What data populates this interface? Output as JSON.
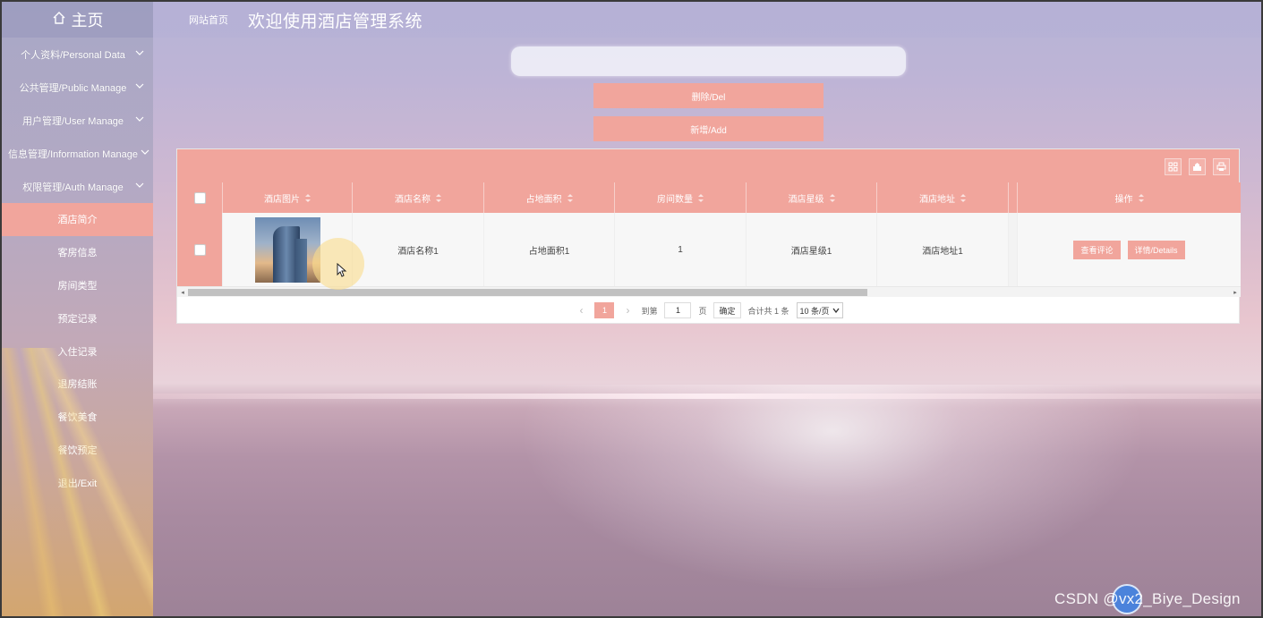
{
  "sidebar": {
    "home_label": "主页",
    "menus": [
      {
        "label": "个人资料/Personal Data"
      },
      {
        "label": "公共管理/Public Manage"
      },
      {
        "label": "用户管理/User Manage"
      },
      {
        "label": "信息管理/Information Manage"
      },
      {
        "label": "权限管理/Auth Manage"
      }
    ],
    "items": [
      {
        "label": "酒店简介",
        "active": true
      },
      {
        "label": "客房信息"
      },
      {
        "label": "房间类型"
      },
      {
        "label": "预定记录"
      },
      {
        "label": "入住记录"
      },
      {
        "label": "退房结账"
      },
      {
        "label": "餐饮美食"
      },
      {
        "label": "餐饮预定"
      },
      {
        "label": "退出/Exit"
      }
    ]
  },
  "header": {
    "breadcrumb": "网站首页",
    "title": "欢迎使用酒店管理系统"
  },
  "search": {
    "placeholder": ""
  },
  "actions": {
    "delete_label": "删除/Del",
    "add_label": "新增/Add"
  },
  "table": {
    "columns": [
      "酒店图片",
      "酒店名称",
      "占地面积",
      "房间数量",
      "酒店星级",
      "酒店地址",
      "操作"
    ],
    "rows": [
      {
        "name": "酒店名称1",
        "area": "占地面积1",
        "rooms": "1",
        "stars": "酒店星级1",
        "address": "酒店地址1",
        "btn_review": "查看评论",
        "btn_details": "详情/Details"
      }
    ]
  },
  "pager": {
    "current": "1",
    "goto_prefix": "到第",
    "goto_value": "1",
    "goto_suffix": "页",
    "confirm": "确定",
    "total": "合计共 1 条",
    "page_size": "10 条/页"
  },
  "watermark": "CSDN @vx2_Biye_Design",
  "colors": {
    "accent": "#f1a59c"
  }
}
